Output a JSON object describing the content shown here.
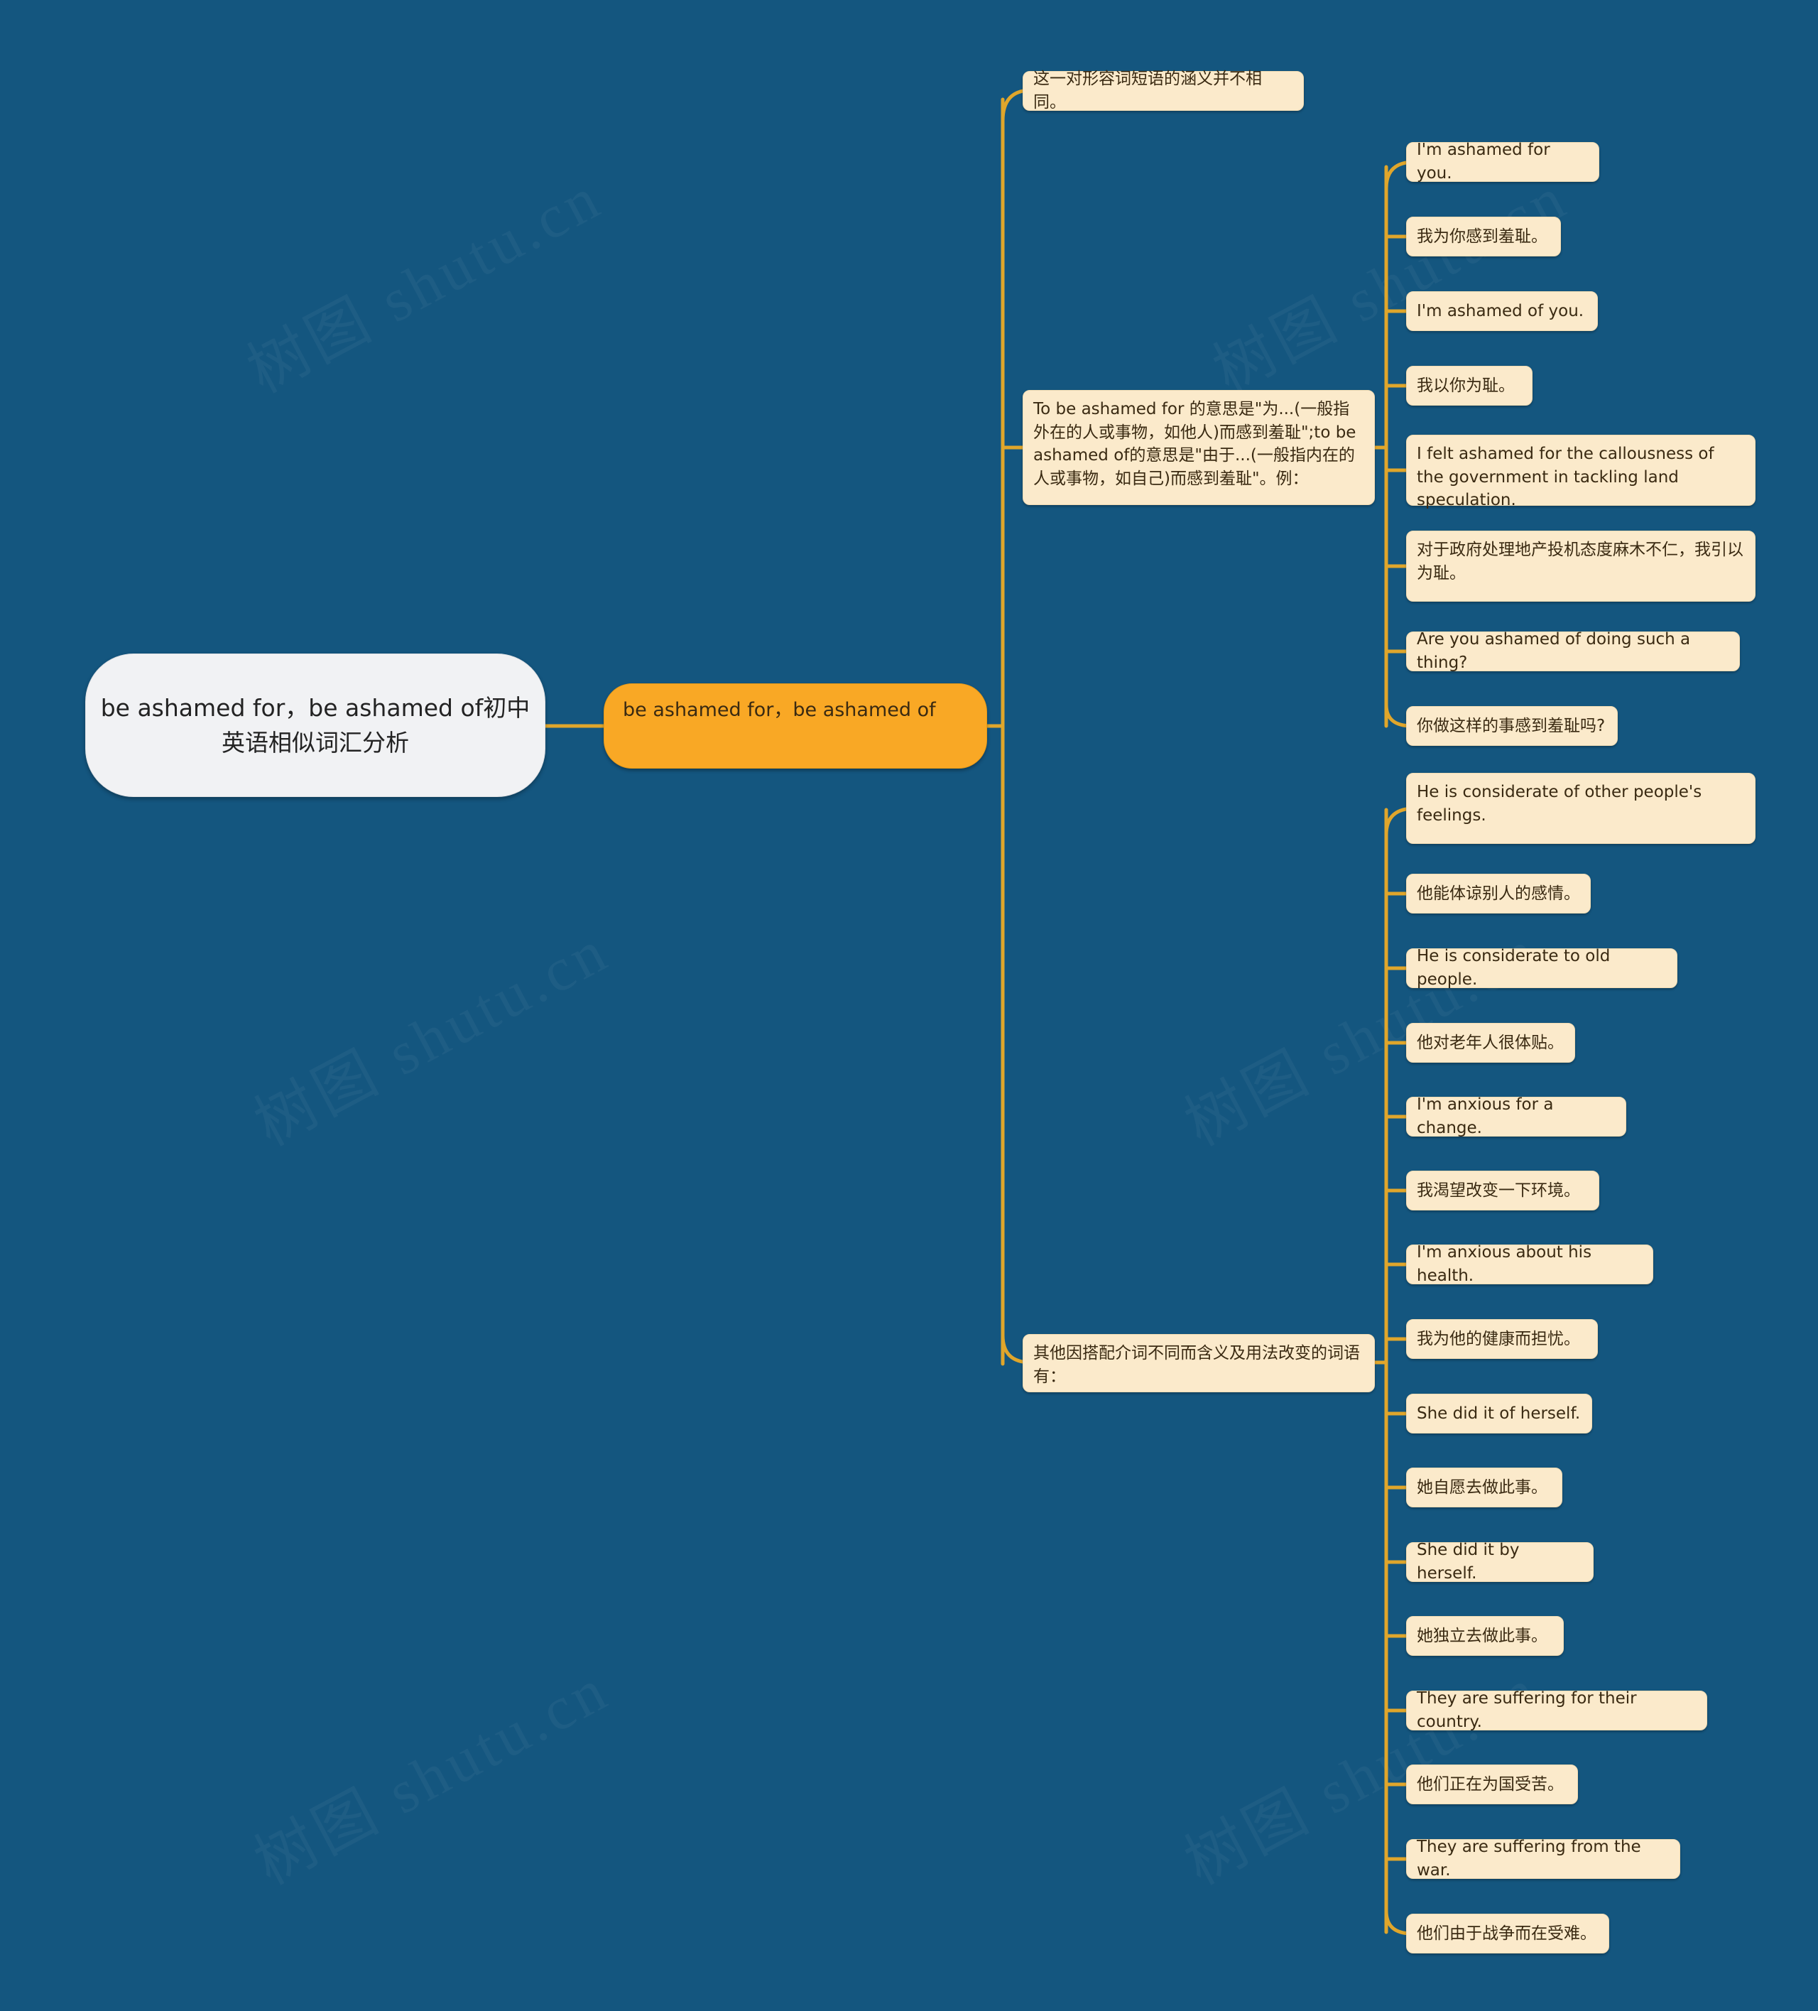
{
  "canvas": {
    "background_color": "#14567f",
    "connector_color": "#e0a62b",
    "leaf_fill": "#fbeacb",
    "topic_fill": "#f9a825",
    "root_fill": "#f1f2f4",
    "watermark_text_1": "树图 shutu.cn",
    "watermark_text_2": "树图 shutu.cn",
    "watermark_text_3": "树图 shutu.cn",
    "watermark_text_4": "树图 shutu.cn",
    "watermark_text_5": "树图 shutu.cn",
    "watermark_text_6": "树图 shutu.cn"
  },
  "mindmap": {
    "root": {
      "label": "be ashamed for，be ashamed of初中英语相似词汇分析"
    },
    "topic": {
      "label": "be ashamed for，be ashamed of"
    },
    "branches": [
      {
        "id": "branch-1",
        "label": "这一对形容词短语的涵义并不相同。",
        "children": []
      },
      {
        "id": "branch-2",
        "label": "To be ashamed for 的意思是\"为...(一般指外在的人或事物，如他人)而感到羞耻\";to be ashamed of的意思是\"由于...(一般指内在的人或事物，如自己)而感到羞耻\"。例：",
        "children": [
          {
            "id": "leaf-1",
            "label": "I'm ashamed for you."
          },
          {
            "id": "leaf-2",
            "label": "我为你感到羞耻。"
          },
          {
            "id": "leaf-3",
            "label": "I'm ashamed of you."
          },
          {
            "id": "leaf-4",
            "label": "我以你为耻。"
          },
          {
            "id": "leaf-5",
            "label": "I felt ashamed for the callousness of the government in tackling land speculation."
          },
          {
            "id": "leaf-6",
            "label": "对于政府处理地产投机态度麻木不仁，我引以为耻。"
          },
          {
            "id": "leaf-7",
            "label": "Are you ashamed of doing such a thing?"
          },
          {
            "id": "leaf-8",
            "label": "你做这样的事感到羞耻吗?"
          }
        ]
      },
      {
        "id": "branch-3",
        "label": "其他因搭配介词不同而含义及用法改变的词语有：",
        "children": [
          {
            "id": "leaf-9",
            "label": "He is considerate of other people's feelings."
          },
          {
            "id": "leaf-10",
            "label": "他能体谅别人的感情。"
          },
          {
            "id": "leaf-11",
            "label": "He is considerate to old people."
          },
          {
            "id": "leaf-12",
            "label": "他对老年人很体贴。"
          },
          {
            "id": "leaf-13",
            "label": "I'm anxious for a change."
          },
          {
            "id": "leaf-14",
            "label": "我渴望改变一下环境。"
          },
          {
            "id": "leaf-15",
            "label": "I'm anxious about his health."
          },
          {
            "id": "leaf-16",
            "label": "我为他的健康而担忧。"
          },
          {
            "id": "leaf-17",
            "label": "She did it of herself."
          },
          {
            "id": "leaf-18",
            "label": "她自愿去做此事。"
          },
          {
            "id": "leaf-19",
            "label": "She did it by herself."
          },
          {
            "id": "leaf-20",
            "label": "她独立去做此事。"
          },
          {
            "id": "leaf-21",
            "label": "They are suffering for their country."
          },
          {
            "id": "leaf-22",
            "label": "他们正在为国受苦。"
          },
          {
            "id": "leaf-23",
            "label": "They are suffering from the war."
          },
          {
            "id": "leaf-24",
            "label": "他们由于战争而在受难。"
          }
        ]
      }
    ]
  }
}
